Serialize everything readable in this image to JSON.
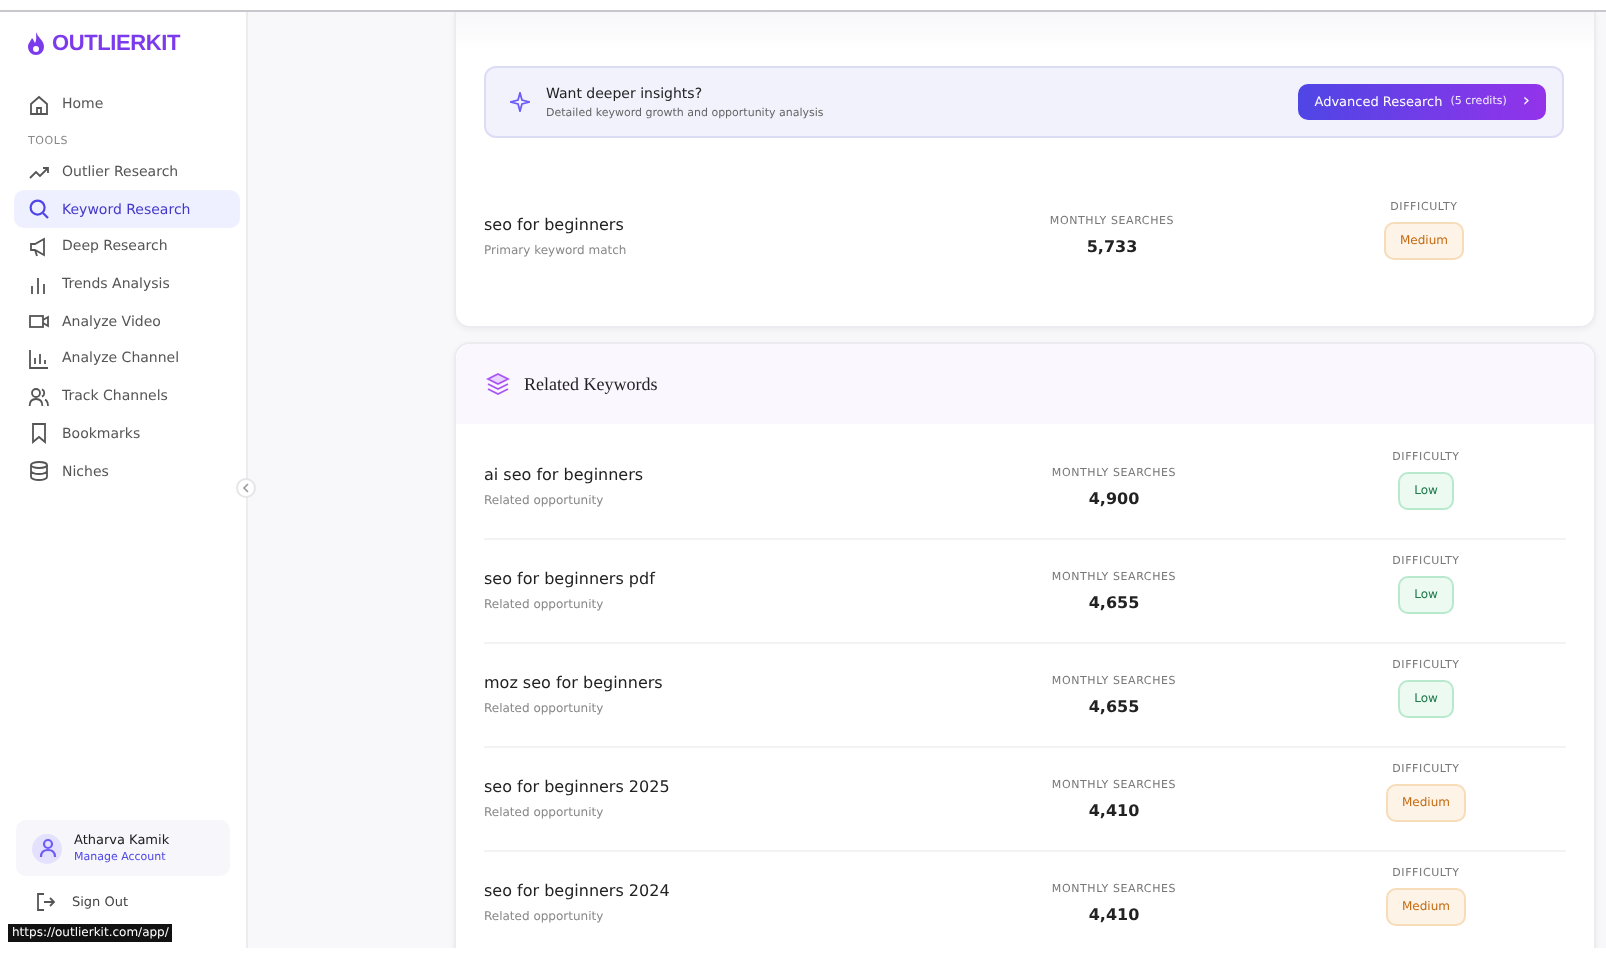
{
  "sidebar": {
    "logo": "OUTLIERKIT",
    "items": [
      {
        "label": "Home",
        "selected": false
      }
    ],
    "section": "TOOLS",
    "tools": [
      {
        "label": "Outlier Research",
        "selected": false
      },
      {
        "label": "Keyword Research",
        "selected": true
      },
      {
        "label": "Deep Research",
        "selected": false
      },
      {
        "label": "Trends Analysis",
        "selected": false
      },
      {
        "label": "Analyze Video",
        "selected": false
      },
      {
        "label": "Analyze Channel",
        "selected": false
      },
      {
        "label": "Track Channels",
        "selected": false
      },
      {
        "label": "Bookmarks",
        "selected": false
      },
      {
        "label": "Niches",
        "selected": false
      }
    ],
    "user": {
      "name": "Atharva Kamik",
      "link": "Manage Account"
    },
    "sign_out": "Sign Out"
  },
  "insights": {
    "title": "Want deeper insights?",
    "subtitle": "Detailed keyword growth and opportunity analysis",
    "button": "Advanced Research",
    "credits": "(5 credits)",
    "chevron": "›"
  },
  "primary": {
    "keyword": "seo for beginners",
    "note": "Primary keyword match",
    "searches_label": "MONTHLY SEARCHES",
    "searches": "5,733",
    "difficulty_label": "DIFFICULTY",
    "difficulty": "Medium",
    "kind": "medium"
  },
  "related": {
    "title": "Related Keywords",
    "rows": [
      {
        "keyword": "ai seo for beginners",
        "note": "Related opportunity",
        "searches_label": "MONTHLY SEARCHES",
        "searches": "4,900",
        "difficulty_label": "DIFFICULTY",
        "difficulty": "Low",
        "kind": "low"
      },
      {
        "keyword": "seo for beginners pdf",
        "note": "Related opportunity",
        "searches_label": "MONTHLY SEARCHES",
        "searches": "4,655",
        "difficulty_label": "DIFFICULTY",
        "difficulty": "Low",
        "kind": "low"
      },
      {
        "keyword": "moz seo for beginners",
        "note": "Related opportunity",
        "searches_label": "MONTHLY SEARCHES",
        "searches": "4,655",
        "difficulty_label": "DIFFICULTY",
        "difficulty": "Low",
        "kind": "low"
      },
      {
        "keyword": "seo for beginners 2025",
        "note": "Related opportunity",
        "searches_label": "MONTHLY SEARCHES",
        "searches": "4,410",
        "difficulty_label": "DIFFICULTY",
        "difficulty": "Medium",
        "kind": "medium"
      },
      {
        "keyword": "seo for beginners 2024",
        "note": "Related opportunity",
        "searches_label": "MONTHLY SEARCHES",
        "searches": "4,410",
        "difficulty_label": "DIFFICULTY",
        "difficulty": "Medium",
        "kind": "medium"
      }
    ]
  },
  "status_url": "https://outlierkit.com/app/"
}
